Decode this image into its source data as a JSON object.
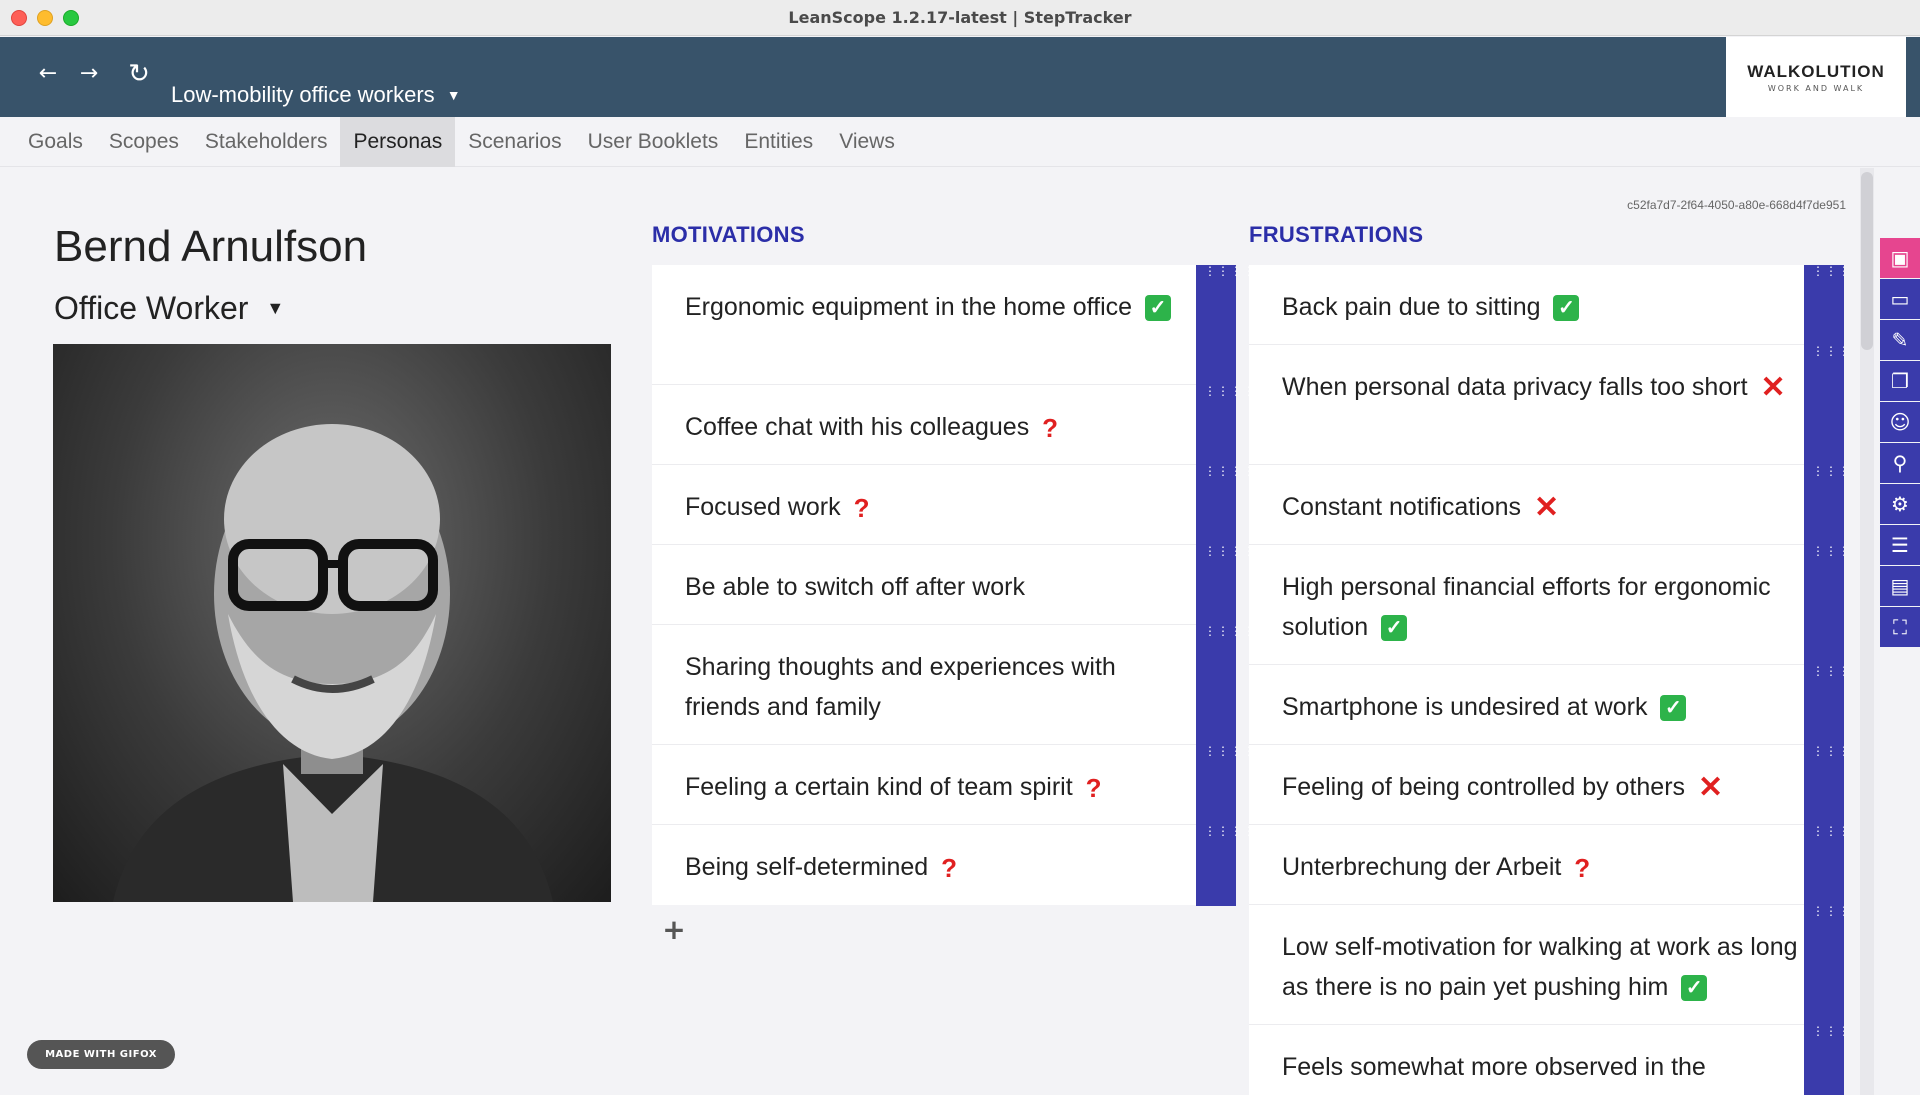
{
  "window": {
    "title": "LeanScope 1.2.17-latest | StepTracker"
  },
  "header": {
    "scope_title": "Low-mobility office workers",
    "logo_main": "WALKOLUTION",
    "logo_sub": "WORK AND WALK"
  },
  "nav": {
    "tabs": [
      "Goals",
      "Scopes",
      "Stakeholders",
      "Personas",
      "Scenarios",
      "User Booklets",
      "Entities",
      "Views"
    ],
    "active": "Personas"
  },
  "persona": {
    "id": "c52fa7d7-2f64-4050-a80e-668d4f7de951",
    "name": "Bernd Arnulfson",
    "role": "Office Worker"
  },
  "motivations": {
    "title": "MOTIVATIONS",
    "items": [
      {
        "text": "Ergonomic equipment in the home office",
        "mark": "check"
      },
      {
        "text": "Coffee chat with his colleagues",
        "mark": "question"
      },
      {
        "text": "Focused work",
        "mark": "question"
      },
      {
        "text": "Be able to switch off after work",
        "mark": "none"
      },
      {
        "text": "Sharing thoughts and experiences with friends and family",
        "mark": "none"
      },
      {
        "text": "Feeling a certain kind of team spirit",
        "mark": "question"
      },
      {
        "text": "Being self-determined",
        "mark": "question"
      }
    ]
  },
  "frustrations": {
    "title": "FRUSTRATIONS",
    "items": [
      {
        "text": "Back pain due to sitting",
        "mark": "check"
      },
      {
        "text": "When personal data privacy falls too short",
        "mark": "cross"
      },
      {
        "text": "Constant notifications",
        "mark": "cross"
      },
      {
        "text": "High personal financial efforts for ergonomic solution",
        "mark": "check"
      },
      {
        "text": "Smartphone is undesired at work",
        "mark": "check"
      },
      {
        "text": "Feeling of being controlled by others",
        "mark": "cross"
      },
      {
        "text": "Unterbrechung der Arbeit",
        "mark": "question"
      },
      {
        "text": "Low self-motivation for walking at work as long as there is no pain yet pushing him",
        "mark": "check"
      },
      {
        "text": "Feels somewhat more observed in the",
        "mark": "none"
      }
    ]
  },
  "sidebar_tools": [
    "presentation-icon",
    "tablet-icon",
    "document-icon",
    "cards-icon",
    "smiley-icon",
    "search-icon",
    "gear-icon",
    "list-icon",
    "contact-card-icon",
    "easel-icon"
  ],
  "badge": {
    "text": "MADE WITH GIFOX"
  },
  "colors": {
    "header": "#38536a",
    "accent": "#3a3bab",
    "heading": "#2b2ea8",
    "active_tool": "#e6458f",
    "check": "#2db34a",
    "alert": "#e02020"
  }
}
